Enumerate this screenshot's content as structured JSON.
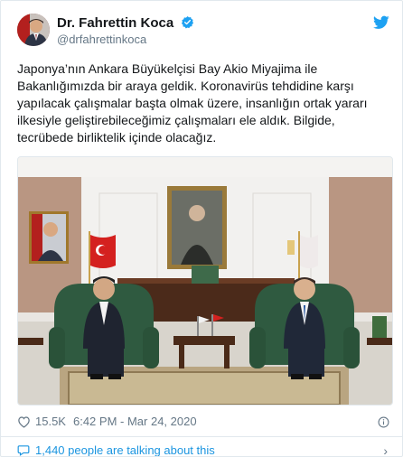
{
  "author": {
    "name": "Dr. Fahrettin Koca",
    "handle": "@drfahrettinkoca",
    "verified": true
  },
  "tweet": {
    "text": "Japonya’nın Ankara Büyükelçisi Bay Akio Miyajima ile\nBakanlığımızda bir araya geldik. Koronavirüs tehdidine karşı\nyapılacak çalışmalar başta olmak üzere, insanlığın ortak yararı\nilkesiyle geliştirebileceğimiz çalışmaları ele aldık. Bilgide,\ntecrübede birliktelik içinde olacağız.",
    "like_count": "15.5K",
    "time": "6:42 PM",
    "date_sep": " - ",
    "date": "Mar 24, 2020"
  },
  "conversation": {
    "label": "1,440 people are talking about this",
    "chevron": "›"
  },
  "icons": {
    "brand": "twitter-bird-icon",
    "like": "heart-icon",
    "info": "info-icon",
    "talk": "comment-icon"
  },
  "colors": {
    "accent": "#1da1f2",
    "link": "#1b95e0",
    "muted": "#657786",
    "border": "#e1e8ed"
  }
}
